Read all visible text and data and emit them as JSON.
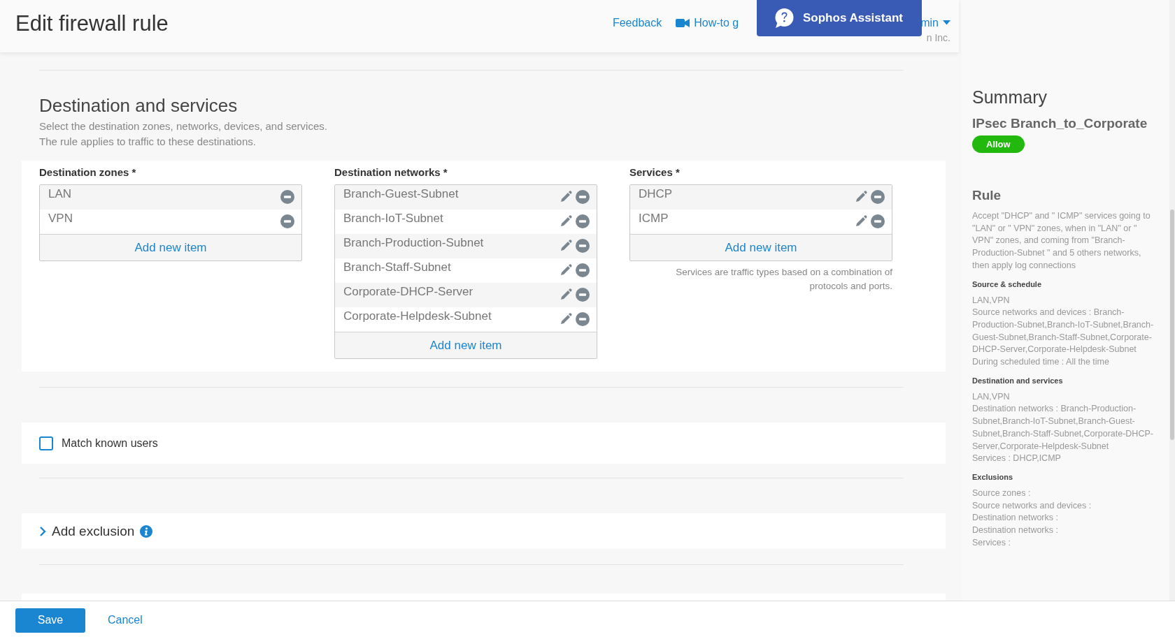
{
  "header": {
    "title": "Edit firewall rule",
    "links": [
      {
        "kind": "text",
        "label": "Feedback"
      },
      {
        "kind": "video",
        "label": "How-to g"
      }
    ],
    "user": {
      "label": "min",
      "subtitle": "n Inc."
    },
    "assistant": {
      "label": "Sophos Assistant"
    }
  },
  "destination": {
    "heading": "Destination and services",
    "description": [
      "Select the destination zones, networks, devices, and services.",
      "The rule applies to traffic to these destinations."
    ],
    "lists": [
      {
        "label": "Destination zones *",
        "editable": false,
        "items": [
          "LAN",
          "VPN"
        ],
        "add_label": "Add new item"
      },
      {
        "label": "Destination networks *",
        "editable": true,
        "items": [
          "Branch-Guest-Subnet",
          "Branch-IoT-Subnet",
          "Branch-Production-Subnet",
          "Branch-Staff-Subnet",
          "Corporate-DHCP-Server",
          "Corporate-Helpdesk-Subnet"
        ],
        "add_label": "Add new item"
      },
      {
        "label": "Services *",
        "editable": true,
        "items": [
          "DHCP",
          "ICMP"
        ],
        "add_label": "Add new item",
        "note": "Services are traffic types based on a combination of protocols and ports."
      }
    ]
  },
  "match_users": {
    "label": "Match known users",
    "checked": false
  },
  "exclusion": {
    "label": "Add exclusion",
    "expanded": false
  },
  "summary": {
    "title": "Summary",
    "rule_name": "IPsec Branch_to_Corporate",
    "action": "Allow",
    "rule_heading": "Rule",
    "rule_text": "Accept \"DHCP\" and \" ICMP\" services going to \"LAN\" or \" VPN\" zones, when in \"LAN\" or \" VPN\" zones, and coming from \"Branch-Production-Subnet \" and 5 others networks, then apply log connections",
    "sections": [
      {
        "heading": "Source & schedule",
        "lines": [
          "LAN,VPN",
          "Source networks and devices : Branch-Production-Subnet,Branch-IoT-Subnet,Branch-Guest-Subnet,Branch-Staff-Subnet,Corporate-DHCP-Server,Corporate-Helpdesk-Subnet",
          "During scheduled time : All the time"
        ]
      },
      {
        "heading": "Destination and services",
        "lines": [
          "LAN,VPN",
          "Destination networks : Branch-Production-Subnet,Branch-IoT-Subnet,Branch-Guest-Subnet,Branch-Staff-Subnet,Corporate-DHCP-Server,Corporate-Helpdesk-Subnet",
          "Services : DHCP,ICMP"
        ]
      },
      {
        "heading": "Exclusions",
        "lines": [
          "Source zones :",
          "Source networks and devices :",
          "Destination networks :",
          "Destination networks :",
          "Services :"
        ]
      }
    ]
  },
  "footer": {
    "buttons": [
      {
        "kind": "primary",
        "label": "Save"
      },
      {
        "kind": "link",
        "label": "Cancel"
      }
    ]
  }
}
